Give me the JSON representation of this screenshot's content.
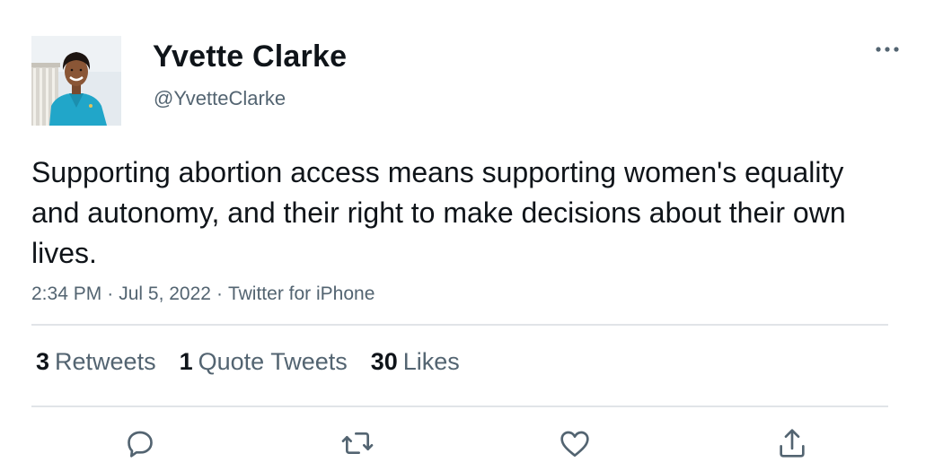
{
  "author": {
    "display_name": "Yvette Clarke",
    "handle": "@YvetteClarke",
    "avatar": "profile-photo"
  },
  "tweet": {
    "text": "Supporting abortion access means supporting women's equality and autonomy, and their right to make decisions about their own lives.",
    "time": "2:34 PM",
    "date": "Jul 5, 2022",
    "source": "Twitter for iPhone",
    "separator": "·"
  },
  "stats": {
    "retweets_count": "3",
    "retweets_label": "Retweets",
    "quotes_count": "1",
    "quotes_label": "Quote Tweets",
    "likes_count": "30",
    "likes_label": "Likes"
  },
  "icons": {
    "more": "more-horizontal-icon",
    "reply": "reply-icon",
    "retweet": "retweet-icon",
    "like": "heart-icon",
    "share": "share-icon"
  },
  "colors": {
    "primary_text": "#0f1419",
    "secondary_text": "#536471",
    "divider": "#e1e4e8"
  }
}
